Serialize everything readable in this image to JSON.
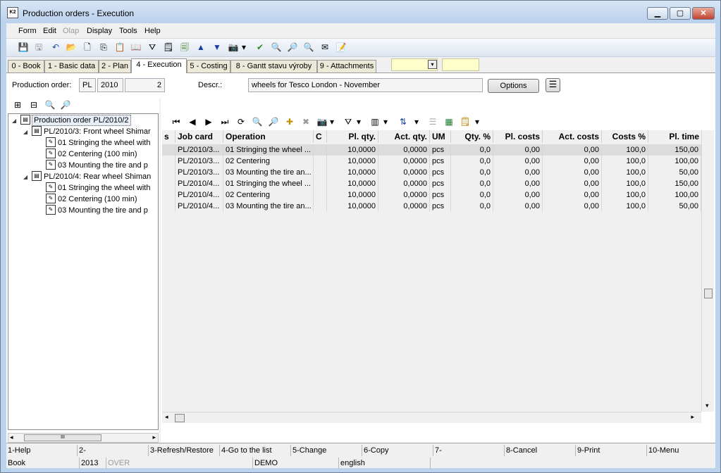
{
  "window": {
    "title": "Production orders - Execution",
    "minimize": "▁",
    "maximize": "▢",
    "close": "✕"
  },
  "menu": [
    "Form",
    "Edit",
    "Olap",
    "Display",
    "Tools",
    "Help"
  ],
  "tabs": [
    "0 - Book",
    "1 - Basic data",
    "2 - Plan",
    "4 - Execution",
    "5 - Costing",
    "8 - Gantt stavu výroby",
    "9 - Attachments"
  ],
  "form": {
    "production_order_label": "Production order:",
    "book": "PL",
    "year": "2010",
    "number": "2",
    "descr_label": "Descr.:",
    "descr": "wheels for Tesco London - November",
    "options_button": "Options"
  },
  "tree": {
    "nodes": [
      {
        "label": "Production order PL/2010/2"
      },
      {
        "label": "PL/2010/3: Front wheel Shimar"
      },
      {
        "label": "01 Stringing the wheel with"
      },
      {
        "label": "02 Centering (100 min)"
      },
      {
        "label": "03 Mounting the tire and p"
      },
      {
        "label": "PL/2010/4: Rear wheel Shiman"
      },
      {
        "label": "01 Stringing the wheel with"
      },
      {
        "label": "02 Centering (100 min)"
      },
      {
        "label": "03 Mounting the tire and p"
      }
    ],
    "scroll_thumb": "III"
  },
  "grid": {
    "columns": [
      "s",
      "Job card",
      "Operation",
      "C",
      "Pl. qty.",
      "Act. qty.",
      "UM",
      "Qty. %",
      "Pl. costs",
      "Act. costs",
      "Costs %",
      "Pl. time"
    ],
    "rows": [
      [
        "",
        "PL/2010/3...",
        "01 Stringing the wheel ...",
        "",
        "10,0000",
        "0,0000",
        "pcs",
        "0,0",
        "0,00",
        "0,00",
        "100,0",
        "150,00"
      ],
      [
        "",
        "PL/2010/3...",
        "02 Centering",
        "",
        "10,0000",
        "0,0000",
        "pcs",
        "0,0",
        "0,00",
        "0,00",
        "100,0",
        "100,00"
      ],
      [
        "",
        "PL/2010/3...",
        "03 Mounting the tire an...",
        "",
        "10,0000",
        "0,0000",
        "pcs",
        "0,0",
        "0,00",
        "0,00",
        "100,0",
        "50,00"
      ],
      [
        "",
        "PL/2010/4...",
        "01 Stringing the wheel ...",
        "",
        "10,0000",
        "0,0000",
        "pcs",
        "0,0",
        "0,00",
        "0,00",
        "100,0",
        "150,00"
      ],
      [
        "",
        "PL/2010/4...",
        "02 Centering",
        "",
        "10,0000",
        "0,0000",
        "pcs",
        "0,0",
        "0,00",
        "0,00",
        "100,0",
        "100,00"
      ],
      [
        "",
        "PL/2010/4...",
        "03 Mounting the tire an...",
        "",
        "10,0000",
        "0,0000",
        "pcs",
        "0,0",
        "0,00",
        "0,00",
        "100,0",
        "50,00"
      ]
    ]
  },
  "fkeys": [
    "1-Help",
    "2-",
    "3-Refresh/Restore",
    "4-Go to the list",
    "5-Change",
    "6-Copy",
    "7-",
    "8-Cancel",
    "9-Print",
    "10-Menu"
  ],
  "status": {
    "book": "Book",
    "year": "2013",
    "over": "OVER",
    "db": "DEMO",
    "language": "english"
  },
  "icons": {
    "save": "💾",
    "save_as": "🖫",
    "undo": "↶",
    "open": "📂",
    "new": "🗋",
    "copy": "⎘",
    "paste": "📋",
    "book": "📖",
    "filter": "⛛",
    "report": "🗒",
    "stack": "🗐",
    "up": "▲",
    "down": "▼",
    "camera": "📷",
    "dropdown": "▾",
    "check": "✔",
    "find": "🔍",
    "find_next": "🔎",
    "mail": "✉",
    "notes": "📝",
    "expand_all": "⊞",
    "collapse_all": "⊟",
    "first": "⏮",
    "prev": "◀",
    "next": "▶",
    "last": "⏭",
    "refresh": "⟳",
    "add": "✚",
    "remove": "✖",
    "sort": "⇅",
    "list": "☰",
    "excel": "▦",
    "columns": "▥",
    "tree_expanded": "◢",
    "doc": "▤",
    "op": "✎",
    "scroll_up": "▴",
    "scroll_down": "▾",
    "scroll_left": "◂",
    "scroll_right": "▸"
  }
}
